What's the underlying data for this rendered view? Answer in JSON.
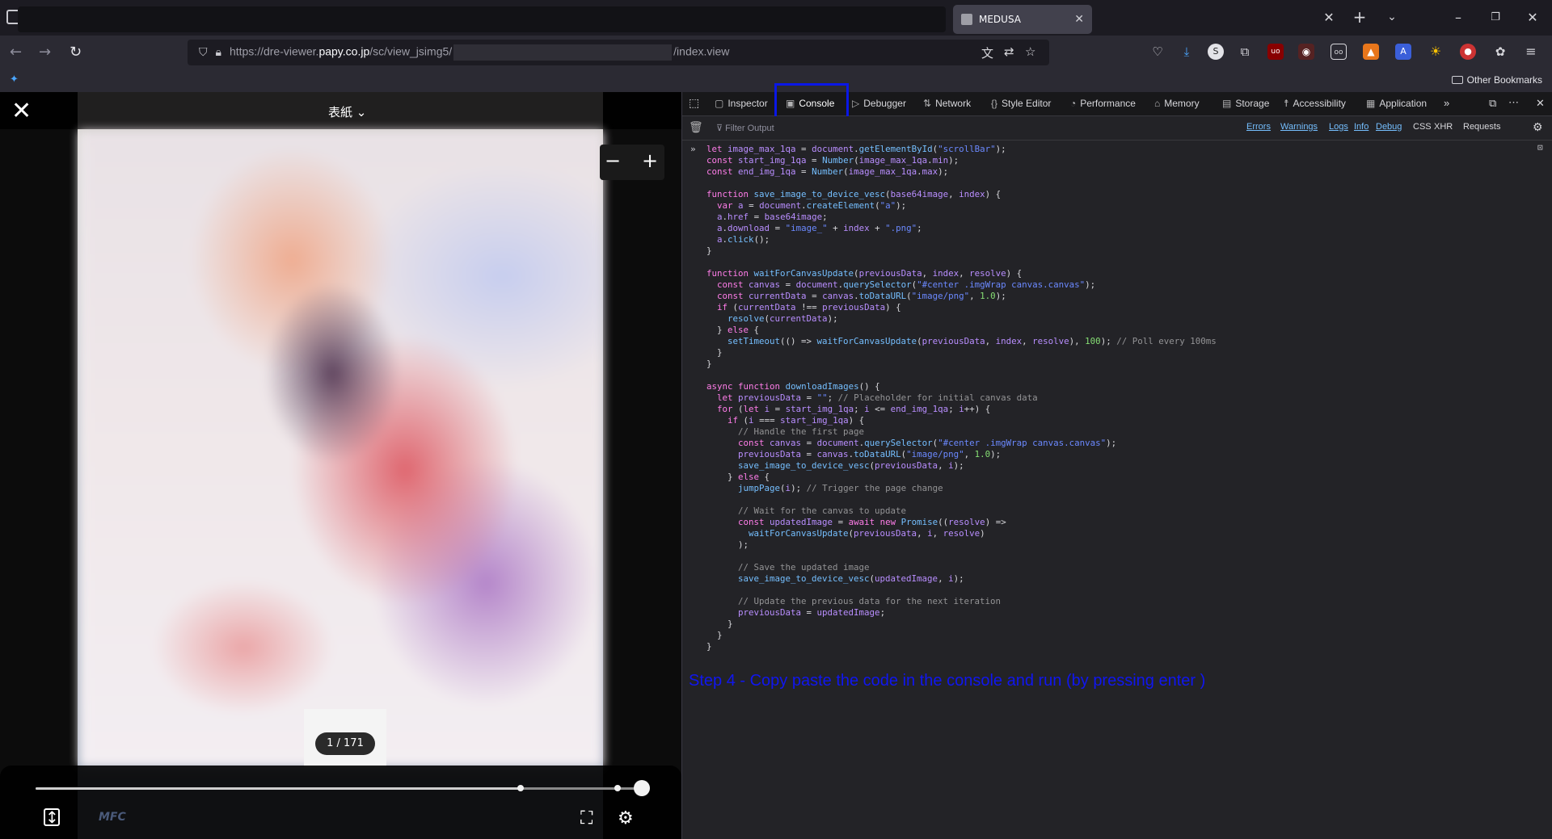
{
  "browser": {
    "tab_title": "MEDUSA",
    "url_prefix": "https://dre-viewer.",
    "url_domain": "papy.co.jp",
    "url_path": "/sc/view_jsimg5/",
    "url_suffix": "/index.view",
    "other_bookmarks": "Other Bookmarks"
  },
  "reader": {
    "chapter_title": "表紙",
    "page_indicator": "1 / 171",
    "progress": 0.8,
    "logo_text": "MFC"
  },
  "devtools": {
    "tabs": [
      "Inspector",
      "Console",
      "Debugger",
      "Network",
      "Style Editor",
      "Performance",
      "Memory",
      "Storage",
      "Accessibility",
      "Application"
    ],
    "active_tab": "Console",
    "filter_placeholder": "Filter Output",
    "levels": [
      "Errors",
      "Warnings",
      "Logs",
      "Info",
      "Debug"
    ],
    "extra_filters": [
      "CSS",
      "XHR",
      "Requests"
    ],
    "code_lines": [
      "let image_max_1qa = document.getElementById(\"scrollBar\");",
      "const start_img_1qa = Number(image_max_1qa.min);",
      "const end_img_1qa = Number(image_max_1qa.max);",
      "",
      "function save_image_to_device_vesc(base64image, index) {",
      "  var a = document.createElement(\"a\");",
      "  a.href = base64image;",
      "  a.download = \"image_\" + index + \".png\";",
      "  a.click();",
      "}",
      "",
      "function waitForCanvasUpdate(previousData, index, resolve) {",
      "  const canvas = document.querySelector(\"#center .imgWrap canvas.canvas\");",
      "  const currentData = canvas.toDataURL(\"image/png\", 1.0);",
      "  if (currentData !== previousData) {",
      "    resolve(currentData);",
      "  } else {",
      "    setTimeout(() => waitForCanvasUpdate(previousData, index, resolve), 100); // Poll every 100ms",
      "  }",
      "}",
      "",
      "async function downloadImages() {",
      "  let previousData = \"\"; // Placeholder for initial canvas data",
      "  for (let i = start_img_1qa; i <= end_img_1qa; i++) {",
      "    if (i === start_img_1qa) {",
      "      // Handle the first page",
      "      const canvas = document.querySelector(\"#center .imgWrap canvas.canvas\");",
      "      previousData = canvas.toDataURL(\"image/png\", 1.0);",
      "      save_image_to_device_vesc(previousData, i);",
      "    } else {",
      "      jumpPage(i); // Trigger the page change",
      "",
      "      // Wait for the canvas to update",
      "      const updatedImage = await new Promise((resolve) =>",
      "        waitForCanvasUpdate(previousData, i, resolve)",
      "      );",
      "",
      "      // Save the updated image",
      "      save_image_to_device_vesc(updatedImage, i);",
      "",
      "      // Update the previous data for the next iteration",
      "      previousData = updatedImage;",
      "    }",
      "  }",
      "}"
    ],
    "caption": "Step 4 - Copy paste the code in the console and run (by pressing enter )"
  },
  "colors": {
    "highlight": "#0a17e6",
    "caption": "#1016f0",
    "devtools_bg": "#232327"
  }
}
